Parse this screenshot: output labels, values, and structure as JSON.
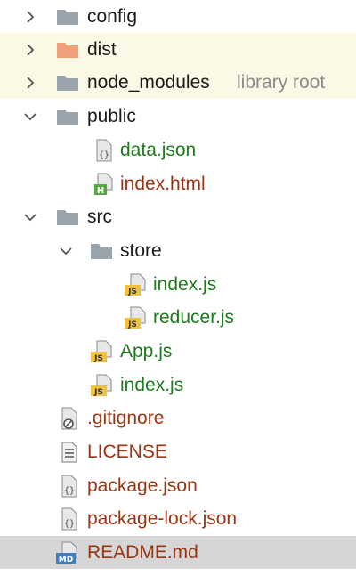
{
  "tree": {
    "config": {
      "label": "config"
    },
    "dist": {
      "label": "dist"
    },
    "node_modules": {
      "label": "node_modules",
      "hint": "library root"
    },
    "public": {
      "label": "public",
      "data_json": "data.json",
      "index_html": "index.html"
    },
    "src": {
      "label": "src",
      "store": {
        "label": "store",
        "index_js": "index.js",
        "reducer_js": "reducer.js"
      },
      "app_js": "App.js",
      "index_js": "index.js"
    },
    "gitignore": ".gitignore",
    "license": "LICENSE",
    "package_json": "package.json",
    "package_lock": "package-lock.json",
    "readme": "README.md"
  },
  "colors": {
    "folder": "#9aa4ad",
    "excluded_folder": "#f0a07a",
    "excluded_row_bg": "#fbf8e6",
    "selected_row_bg": "#d6d6d6",
    "new_file_text": "#1f7a1f",
    "modified_text": "#9a3412",
    "js_badge": "#f0c040",
    "html_badge": "#5aa645",
    "md_badge": "#3f7fbf"
  },
  "icons": {
    "folder": "folder-icon",
    "json": "json-file-icon",
    "html": "html-file-icon",
    "js": "js-file-icon",
    "gitignore": "ignore-file-icon",
    "text": "text-file-icon",
    "markdown": "markdown-file-icon"
  },
  "badges": {
    "html": "H",
    "js": "JS",
    "md": "MD"
  }
}
